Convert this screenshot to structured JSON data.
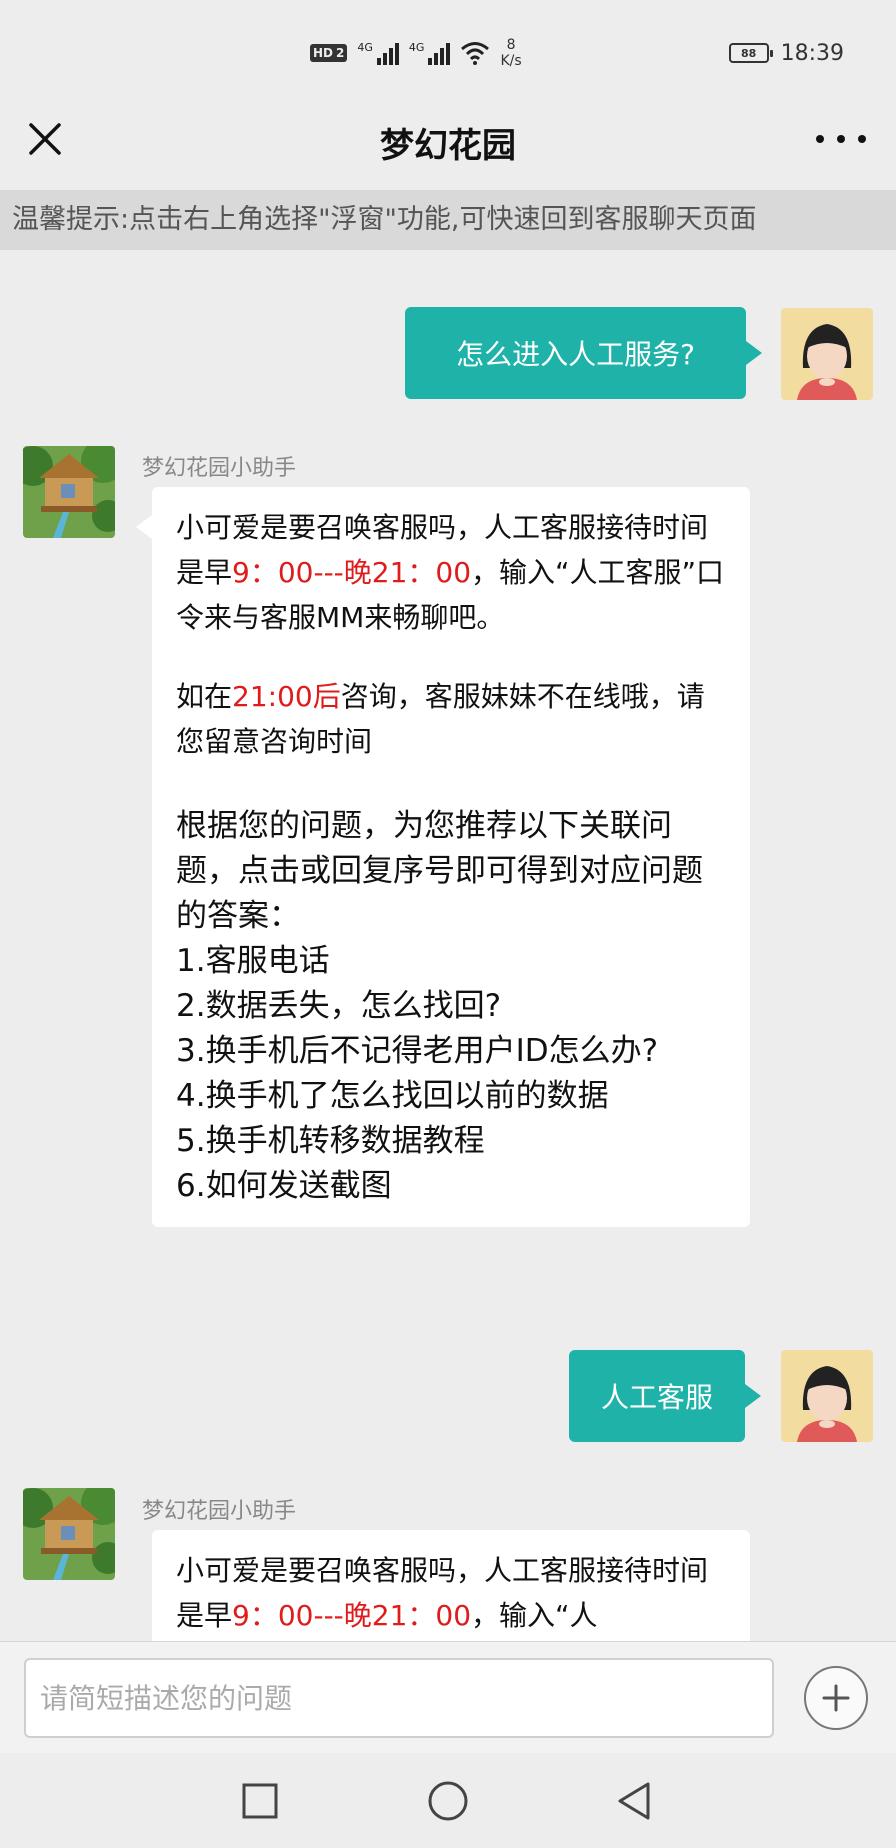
{
  "status_bar": {
    "hd": "HD",
    "sim": "2",
    "net1": "4G",
    "net2": "4G",
    "speed_value": "8",
    "speed_unit": "K/s",
    "battery": "88",
    "time": "18:39"
  },
  "header": {
    "title": "梦幻花园",
    "close_icon": "close-icon",
    "more_icon": "more-icon"
  },
  "tip": "温馨提示:点击右上角选择\"浮窗\"功能,可快速回到客服聊天页面",
  "messages": [
    {
      "from": "user",
      "text": "怎么进入人工服务?"
    },
    {
      "from": "bot",
      "sender": "梦幻花园小助手",
      "p1_a": "小可爱是要召唤客服吗，人工客服接待时间是早",
      "p1_red": "9：00---晚21：00",
      "p1_b": "，输入“人工客服”口令来与客服MM来畅聊吧。",
      "p2_a": "如在",
      "p2_red": "21:00后",
      "p2_b": "咨询，客服妹妹不在线哦，请您留意咨询时间",
      "p3_intro": "根据您的问题，为您推荐以下关联问题，点击或回复序号即可得到对应问题的答案：",
      "items": [
        "1.客服电话",
        "2.数据丢失，怎么找回?",
        "3.换手机后不记得老用户ID怎么办?",
        "4.换手机了怎么找回以前的数据",
        "5.换手机转移数据教程",
        "6.如何发送截图"
      ]
    },
    {
      "from": "user",
      "text": "人工客服"
    },
    {
      "from": "bot",
      "sender": "梦幻花园小助手",
      "p1_a": "小可爱是要召唤客服吗，人工客服接待时间是早",
      "p1_red": "9：00---晚21：00",
      "p1_b": "，输入“人"
    }
  ],
  "composer": {
    "placeholder": "请简短描述您的问题",
    "plus_icon": "plus-icon"
  },
  "nav": [
    "square-icon",
    "circle-icon",
    "triangle-back-icon"
  ],
  "colors": {
    "accent": "#1fb2a8",
    "highlight": "#e01b1b",
    "background": "#ededed"
  }
}
